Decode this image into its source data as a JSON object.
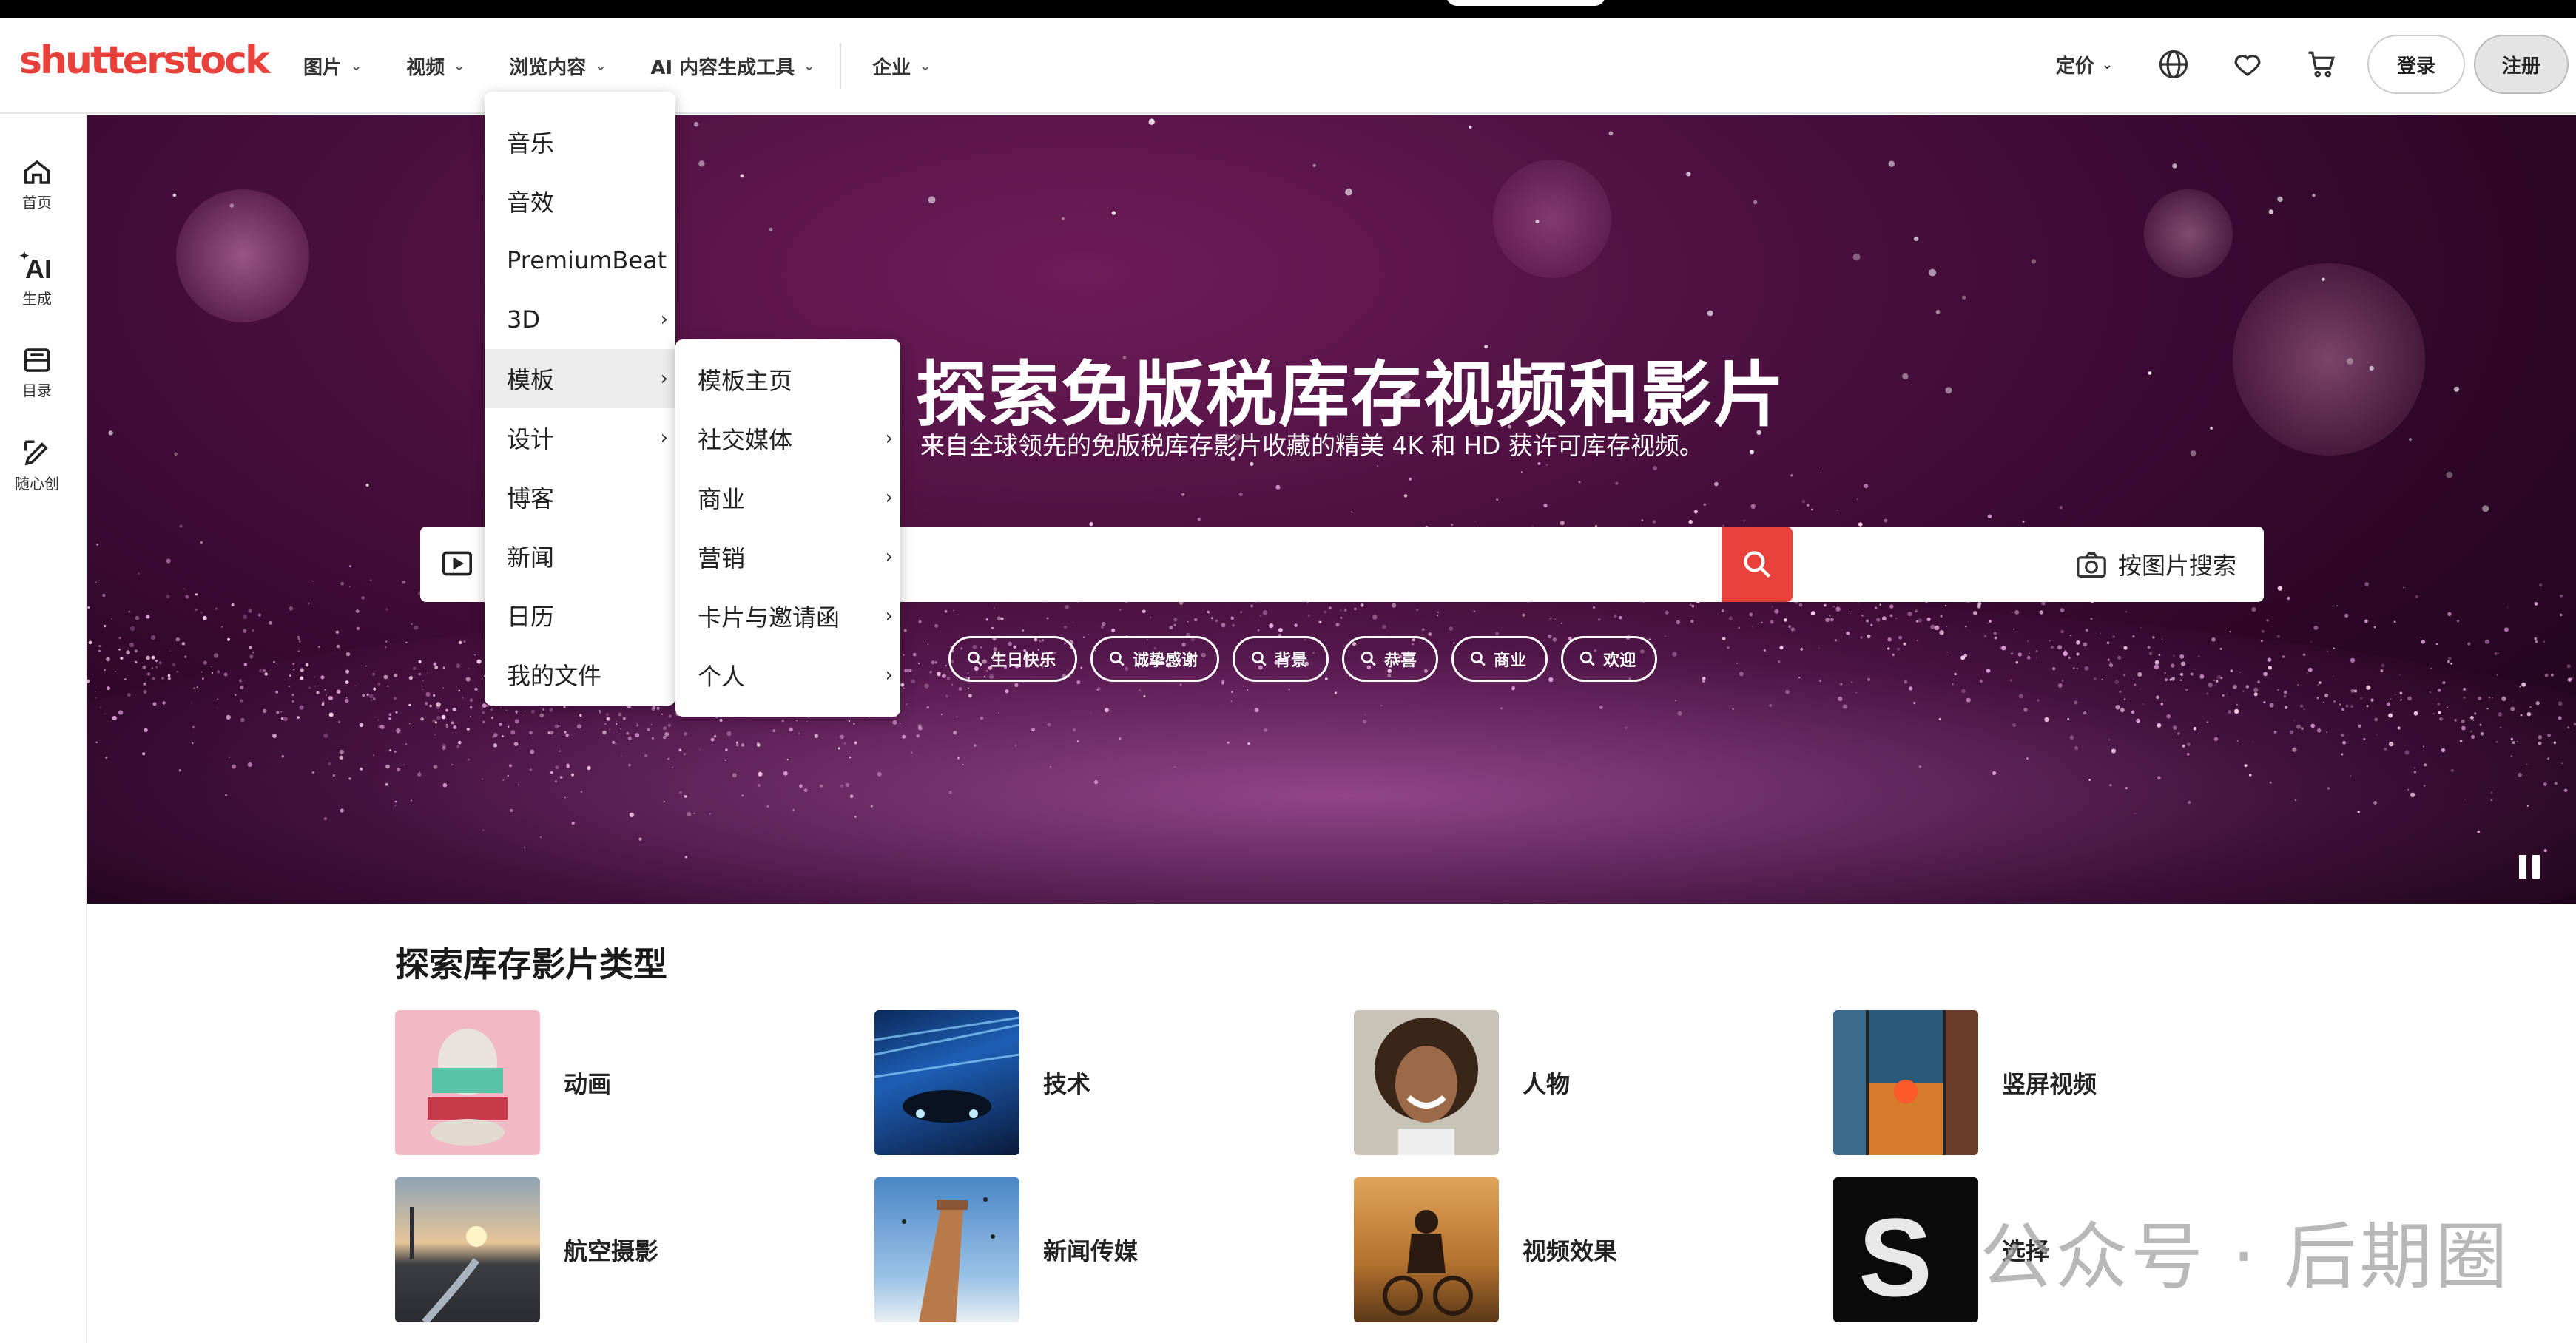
{
  "app": {
    "logo": "shutterstock",
    "brand_color": "#e8403a"
  },
  "header": {
    "nav": [
      {
        "label": "图片"
      },
      {
        "label": "视频"
      },
      {
        "label": "浏览内容"
      },
      {
        "label": "AI 内容生成工具"
      },
      {
        "label": "企业"
      }
    ],
    "pricing": "定价",
    "icons": [
      "globe-icon",
      "heart-icon",
      "cart-icon"
    ],
    "login": "登录",
    "signup": "注册"
  },
  "sidebar": [
    {
      "label": "首页",
      "icon": "home-icon"
    },
    {
      "label": "生成",
      "icon": "ai-generate-icon"
    },
    {
      "label": "目录",
      "icon": "catalog-icon"
    },
    {
      "label": "随心创",
      "icon": "create-icon"
    }
  ],
  "hero": {
    "title": "探索免版税库存视频和影片",
    "subtitle": "来自全球领先的免版税库存影片收藏的精美 4K 和 HD 获许可库存视频。",
    "search_placeholder": "",
    "image_search_label": "按图片搜索",
    "chips": [
      "生日快乐",
      "诚挚感谢",
      "背景",
      "恭喜",
      "商业",
      "欢迎"
    ]
  },
  "browse_menu": {
    "items": [
      {
        "label": "音乐"
      },
      {
        "label": "音效"
      },
      {
        "label": "PremiumBeat"
      },
      {
        "label": "3D",
        "arrow": "›"
      },
      {
        "label": "模板",
        "arrow": "›"
      },
      {
        "label": "设计",
        "arrow": "›"
      },
      {
        "label": "博客"
      },
      {
        "label": "新闻"
      },
      {
        "label": "日历"
      },
      {
        "label": "我的文件"
      }
    ],
    "active": "模板"
  },
  "templates_submenu": {
    "items": [
      {
        "label": "模板主页"
      },
      {
        "label": "社交媒体",
        "arrow": "›"
      },
      {
        "label": "商业",
        "arrow": "›"
      },
      {
        "label": "营销",
        "arrow": "›"
      },
      {
        "label": "卡片与邀请函",
        "arrow": "›"
      },
      {
        "label": "个人",
        "arrow": "›"
      }
    ]
  },
  "categories": {
    "title": "探索库存影片类型",
    "items": [
      {
        "label": "动画"
      },
      {
        "label": "技术"
      },
      {
        "label": "人物"
      },
      {
        "label": "竖屏视频"
      },
      {
        "label": "航空摄影"
      },
      {
        "label": "新闻传媒"
      },
      {
        "label": "视频效果"
      },
      {
        "label": "选择"
      }
    ]
  },
  "watermark": "公众号 · 后期圈"
}
